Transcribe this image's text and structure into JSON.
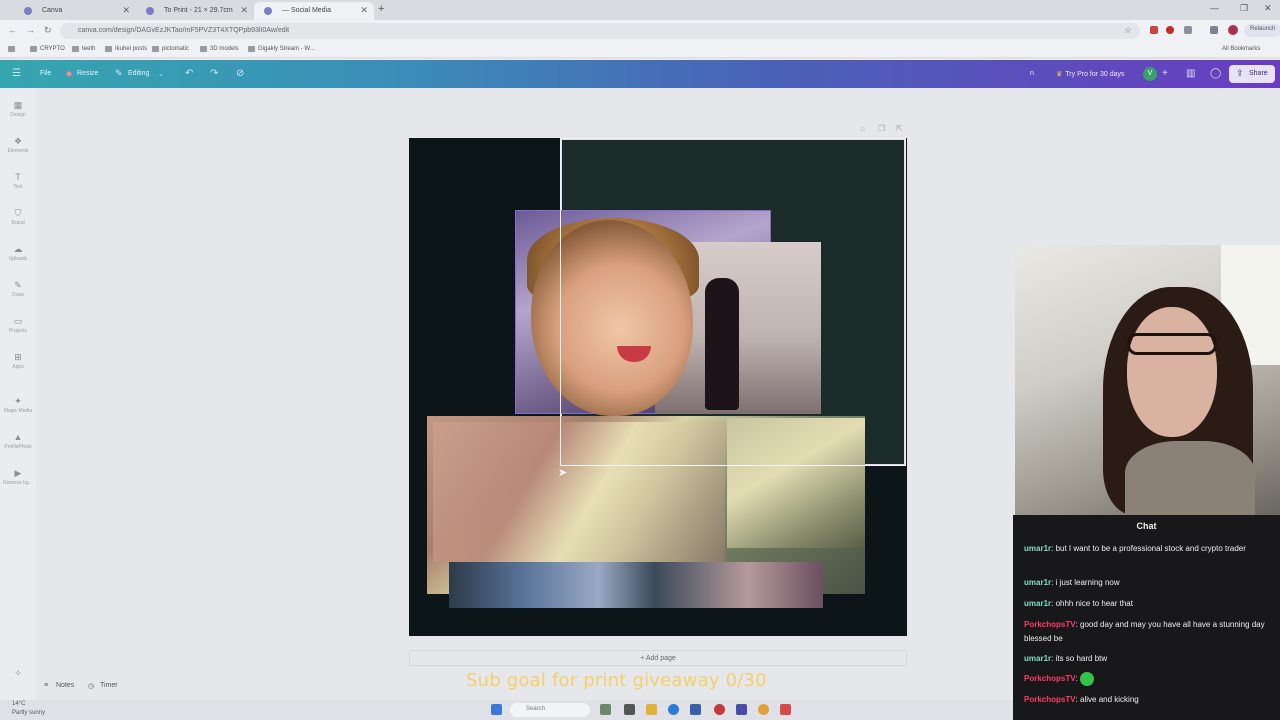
{
  "browser": {
    "tabs": [
      {
        "label": "Canva",
        "active": false
      },
      {
        "label": "To Print - 21 × 29.7cm",
        "active": false
      },
      {
        "label": "— Social Media",
        "active": true
      }
    ],
    "url": "canva.com/design/DAGvEzJKTao/mF5PVZ3T4XTQPpb93lI0Aw/edit",
    "bookmarks": [
      "CRYPTO",
      "teeth",
      "Ikuhei posts",
      "pictomatic",
      "3D models",
      "Gigakly Stream - W..."
    ],
    "all_bookmarks": "All Bookmarks",
    "relaunch_label": "Relaunch"
  },
  "canva": {
    "file_label": "File",
    "resize_label": "Resize",
    "editing_label": "Editing",
    "try_pro_label": "Try Pro for 30 days",
    "user_initial": "V",
    "share_label": "Share",
    "design_name_short": "n",
    "sidebar": [
      {
        "label": "Design",
        "icon": "design-icon"
      },
      {
        "label": "Elements",
        "icon": "elements-icon"
      },
      {
        "label": "Text",
        "icon": "text-icon"
      },
      {
        "label": "Brand",
        "icon": "brand-icon"
      },
      {
        "label": "Uploads",
        "icon": "uploads-icon"
      },
      {
        "label": "Draw",
        "icon": "draw-icon"
      },
      {
        "label": "Projects",
        "icon": "projects-icon"
      },
      {
        "label": "Apps",
        "icon": "apps-icon"
      },
      {
        "label": "Magic Media",
        "icon": "magic-media-icon"
      },
      {
        "label": "ProfilePhoto",
        "icon": "profile-photo-icon"
      },
      {
        "label": "Remove bg...",
        "icon": "remove-bg-icon"
      }
    ],
    "add_page_label": "+ Add page",
    "notes_label": "Notes",
    "timer_label": "Timer"
  },
  "stream": {
    "chat_title": "Chat",
    "messages": [
      {
        "user": "umar1r",
        "text": "but I want to be a professional stock and crypto trader",
        "color": "green"
      },
      {
        "user": "umar1r",
        "text": "i just learning now",
        "color": "green"
      },
      {
        "user": "umar1r",
        "text": "ohhh nice to hear that",
        "color": "green"
      },
      {
        "user": "PorkchopsTV",
        "text": "good day and may you have all have a stunning day blessed be",
        "color": "red"
      },
      {
        "user": "umar1r",
        "text": "its so hard btw",
        "color": "green"
      },
      {
        "user": "PorkchopsTV",
        "text": "",
        "color": "red",
        "emote": true
      },
      {
        "user": "PorkchopsTV",
        "text": "alive and kicking",
        "color": "red"
      }
    ],
    "sub_goal": "Sub goal for print giveaway 0/30"
  },
  "taskbar": {
    "weather_temp": "14°C",
    "weather_desc": "Partly sunny",
    "search_placeholder": "Search"
  }
}
